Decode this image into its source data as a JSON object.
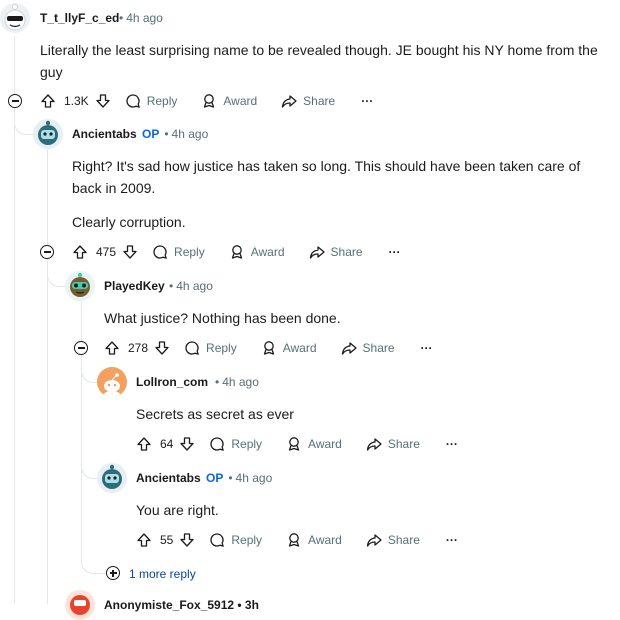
{
  "comments": [
    {
      "username": "T_t_llyF_c_ed",
      "op": "",
      "time": "4h ago",
      "text": "Literally the least surprising name to be revealed though. JE bought his NY home from the guy",
      "votes": "1.3K",
      "reply": "Reply",
      "award": "Award",
      "share": "Share",
      "more": "···",
      "avatar_icon": "snoo-sunglasses-avatar"
    },
    {
      "username": "Ancientabs",
      "op": "OP",
      "time": "4h ago",
      "text_lines": [
        "Right? It's sad how justice has taken so long. This should have been taken care of back in 2009.",
        "Clearly corruption."
      ],
      "votes": "475",
      "reply": "Reply",
      "award": "Award",
      "share": "Share",
      "more": "···",
      "avatar_icon": "snoo-robot-avatar"
    },
    {
      "username": "PlayedKey",
      "op": "",
      "time": "4h ago",
      "text": "What justice? Nothing has been done.",
      "votes": "278",
      "reply": "Reply",
      "award": "Award",
      "share": "Share",
      "more": "···",
      "avatar_icon": "snoo-goggles-avatar"
    },
    {
      "username": "LolIron_com",
      "op": "",
      "time": "4h ago",
      "text": "Secrets as secret as ever",
      "votes": "64",
      "reply": "Reply",
      "award": "Award",
      "share": "Share",
      "more": "···",
      "avatar_icon": "default-snoo-avatar"
    },
    {
      "username": "Ancientabs",
      "op": "OP",
      "time": "4h ago",
      "text": "You are right.",
      "votes": "55",
      "reply": "Reply",
      "award": "Award",
      "share": "Share",
      "more": "···",
      "avatar_icon": "snoo-robot-avatar"
    }
  ],
  "more_replies": "1 more reply",
  "partial_next": "Anonymiste_Fox_5912 • 3h",
  "colors": {
    "meta": "#576f76",
    "op": "#0a66d8",
    "thread_line": "#e2e7e9",
    "link": "#0a449b"
  }
}
